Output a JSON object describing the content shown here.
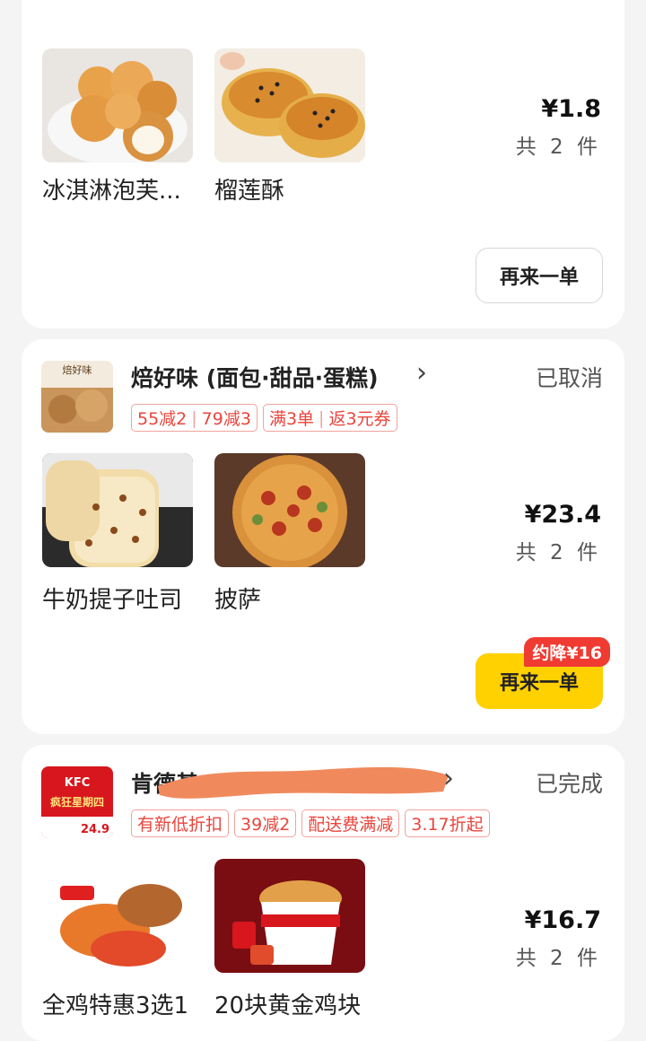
{
  "orders": [
    {
      "items": [
        {
          "name": "冰淇淋泡芙..."
        },
        {
          "name": "榴莲酥"
        }
      ],
      "price": "¥1.8",
      "count": "共 2 件",
      "reorder_label": "再来一单"
    },
    {
      "store": {
        "name": "焙好味 (面包·甜品·蛋糕)",
        "logo_text": "焙好味"
      },
      "status": "已取消",
      "tags": [
        "55减2",
        "79减3",
        "满3单",
        "返3元券"
      ],
      "items": [
        {
          "name": "牛奶提子吐司"
        },
        {
          "name": "披萨"
        }
      ],
      "price": "¥23.4",
      "count": "共 2 件",
      "reorder_label": "再来一单",
      "discount_badge": "约降¥16"
    },
    {
      "store": {
        "name": "肯德基",
        "logo_text": "KFC",
        "logo_promo": "疯狂星期四",
        "logo_price": "24.9"
      },
      "status": "已完成",
      "tags": [
        "有新低折扣",
        "39减2",
        "配送费满减",
        "3.17折起"
      ],
      "items": [
        {
          "name": "全鸡特惠3选1"
        },
        {
          "name": "20块黄金鸡块"
        }
      ],
      "price": "¥16.7",
      "count": "共 2 件"
    }
  ],
  "colors": {
    "accent_yellow": "#ffd100",
    "tag_red": "#e8453c",
    "badge_red": "#f03b32",
    "redaction_orange": "#f08a5d"
  }
}
